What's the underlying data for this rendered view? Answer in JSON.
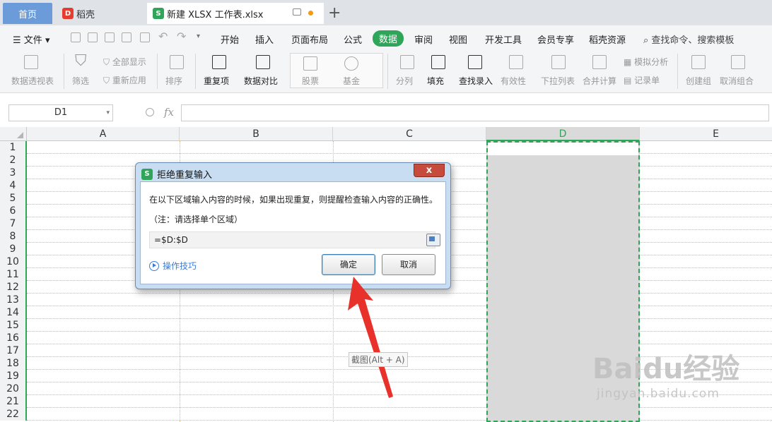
{
  "tabs": {
    "home": "首页",
    "daoke": "稻壳",
    "file": "新建 XLSX 工作表.xlsx",
    "new_tab": "+"
  },
  "menu": {
    "file": "文件",
    "items": [
      "开始",
      "插入",
      "页面布局",
      "公式",
      "数据",
      "审阅",
      "视图",
      "开发工具",
      "会员专享",
      "稻壳资源"
    ],
    "active": "数据",
    "search": "查找命令、搜索模板"
  },
  "ribbon": {
    "pivot": "数据透视表",
    "filter": "筛选",
    "show_all": "全部显示",
    "reapply": "重新应用",
    "sort": "排序",
    "duplicates": "重复项",
    "compare": "数据对比",
    "stock": "股票",
    "fund": "基金",
    "split": "分列",
    "fill": "填充",
    "lookup_entry": "查找录入",
    "validity": "有效性",
    "dropdown": "下拉列表",
    "consolidate": "合并计算",
    "simulation": "模拟分析",
    "record": "记录单",
    "group": "创建组",
    "ungroup": "取消组合"
  },
  "formula_bar": {
    "name_box": "D1",
    "fx": "fx",
    "value": ""
  },
  "sheet": {
    "columns": [
      "A",
      "B",
      "C",
      "D",
      "E"
    ],
    "selected_column": "D",
    "rows": [
      "1",
      "2",
      "3",
      "4",
      "5",
      "6",
      "7",
      "8",
      "9",
      "10",
      "11",
      "12",
      "13",
      "14",
      "15",
      "16",
      "17",
      "18",
      "19",
      "20",
      "21",
      "22"
    ]
  },
  "dialog": {
    "title": "拒绝重复输入",
    "close": "x",
    "message": "在以下区域输入内容的时候，如果出现重复，则提醒检查输入内容的正确性。",
    "note": "（注：请选择单个区域）",
    "range": "=$D:$D",
    "tips": "操作技巧",
    "ok": "确定",
    "cancel": "取消"
  },
  "overlay": {
    "capture_tip": "截图(Alt + A)",
    "watermark": "Baidu经验",
    "watermark_url": "jingyan.baidu.com"
  },
  "colors": {
    "accent": "#2fa55a",
    "home_tab": "#6b9bd8",
    "arrow": "#e8312a"
  }
}
